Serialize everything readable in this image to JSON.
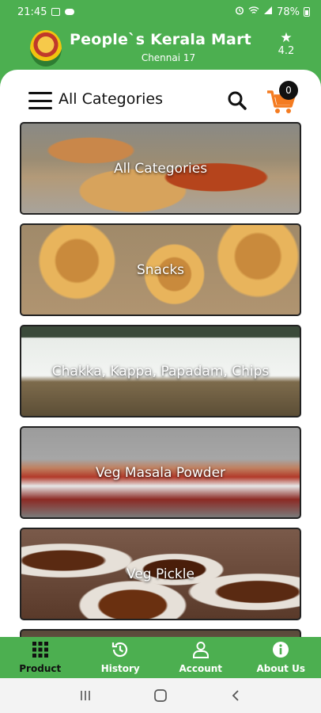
{
  "status_bar": {
    "time": "21:45",
    "battery": "78%"
  },
  "header": {
    "store_name": "People`s Kerala Mart",
    "location": "Chennai 17",
    "rating": "4.2"
  },
  "toolbar": {
    "title": "All Categories",
    "cart_count": "0"
  },
  "categories": [
    {
      "label": "All Categories"
    },
    {
      "label": "Snacks"
    },
    {
      "label": "Chakka, Kappa, Papadam, Chips"
    },
    {
      "label": "Veg Masala Powder"
    },
    {
      "label": "Veg Pickle"
    }
  ],
  "bottom_nav": [
    {
      "label": "Product",
      "icon": "grid-icon",
      "active": true
    },
    {
      "label": "History",
      "icon": "history-icon",
      "active": false
    },
    {
      "label": "Account",
      "icon": "person-icon",
      "active": false
    },
    {
      "label": "About Us",
      "icon": "info-icon",
      "active": false
    }
  ],
  "colors": {
    "brand_green": "#4caf50",
    "cart_orange": "#f47b20"
  }
}
